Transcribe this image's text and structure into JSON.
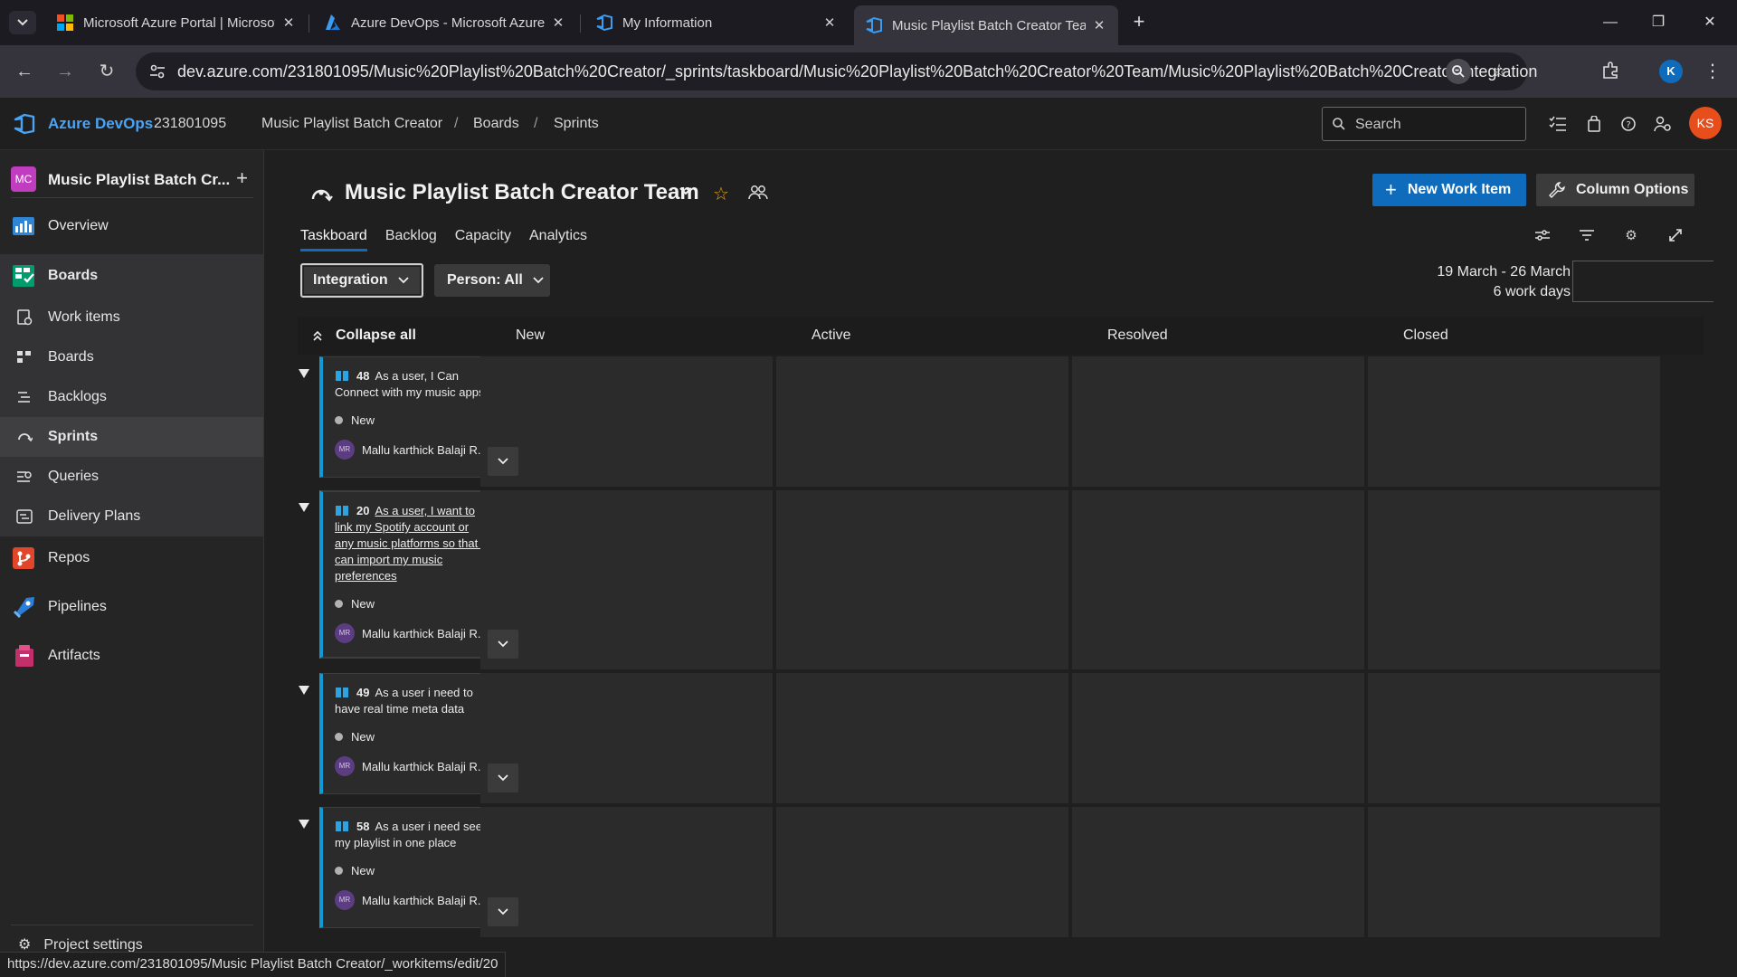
{
  "browser": {
    "tabs": [
      {
        "title": "Microsoft Azure Portal | Microsoft",
        "icon": "microsoft-logo-icon"
      },
      {
        "title": "Azure DevOps - Microsoft Azure",
        "icon": "azure-logo-icon"
      },
      {
        "title": "My Information",
        "icon": "devops-logo-icon"
      },
      {
        "title": "Music Playlist Batch Creator Team",
        "icon": "devops-logo-icon",
        "active": true
      }
    ],
    "url": "dev.azure.com/231801095/Music%20Playlist%20Batch%20Creator/_sprints/taskboard/Music%20Playlist%20Batch%20Creator%20Team/Music%20Playlist%20Batch%20Creator/Integration",
    "profile_initial": "K"
  },
  "header": {
    "brand": "Azure DevOps",
    "org": "231801095",
    "breadcrumbs": [
      "Music Playlist Batch Creator",
      "Boards",
      "Sprints"
    ],
    "search_placeholder": "Search",
    "user_initials": "KS"
  },
  "sidebar": {
    "project_badge": "MC",
    "project_name": "Music Playlist Batch Cr...",
    "items": [
      {
        "label": "Overview",
        "icon": "overview-icon"
      },
      {
        "label": "Boards",
        "icon": "boards-icon"
      },
      {
        "label": "Work items",
        "icon": "work-items-icon"
      },
      {
        "label": "Boards",
        "icon": "kanban-icon"
      },
      {
        "label": "Backlogs",
        "icon": "backlogs-icon"
      },
      {
        "label": "Sprints",
        "icon": "sprints-icon",
        "selected": true
      },
      {
        "label": "Queries",
        "icon": "queries-icon"
      },
      {
        "label": "Delivery Plans",
        "icon": "delivery-plans-icon"
      },
      {
        "label": "Repos",
        "icon": "repos-icon"
      },
      {
        "label": "Pipelines",
        "icon": "pipelines-icon"
      },
      {
        "label": "Artifacts",
        "icon": "artifacts-icon"
      }
    ],
    "project_settings": "Project settings"
  },
  "main": {
    "team_title": "Music Playlist Batch Creator Team",
    "new_work_item": "New Work Item",
    "column_options": "Column Options",
    "pivots": [
      "Taskboard",
      "Backlog",
      "Capacity",
      "Analytics"
    ],
    "iteration": "Integration",
    "person_filter": "Person: All",
    "sprint_dates": "19 March - 26 March",
    "work_days": "6 work days",
    "collapse_all": "Collapse all",
    "columns": [
      "New",
      "Active",
      "Resolved",
      "Closed"
    ],
    "rows": [
      {
        "id": "48",
        "title": "As a user, I Can Connect with my music apps",
        "state": "New",
        "assignee": "Mallu karthick Balaji R...",
        "assignee_initials": "MR"
      },
      {
        "id": "20",
        "title": "As a user, I want to link my Spotify account or any music platforms so that I can import my music preferences",
        "state": "New",
        "assignee": "Mallu karthick Balaji R...",
        "assignee_initials": "MR"
      },
      {
        "id": "49",
        "title": "As a user i need to have real time meta data",
        "state": "New",
        "assignee": "Mallu karthick Balaji R...",
        "assignee_initials": "MR"
      },
      {
        "id": "58",
        "title": "As a user i need see my playlist in one place",
        "state": "New",
        "assignee": "Mallu karthick Balaji R...",
        "assignee_initials": "MR"
      }
    ],
    "card_more": "···"
  },
  "status_url": "https://dev.azure.com/231801095/Music Playlist Batch Creator/_workitems/edit/20",
  "colors": {
    "accent": "#0f6cbd",
    "story_bar": "#0f9ad6",
    "brand_text": "#4aa3f5",
    "user_avatar": "#e74e1c"
  }
}
